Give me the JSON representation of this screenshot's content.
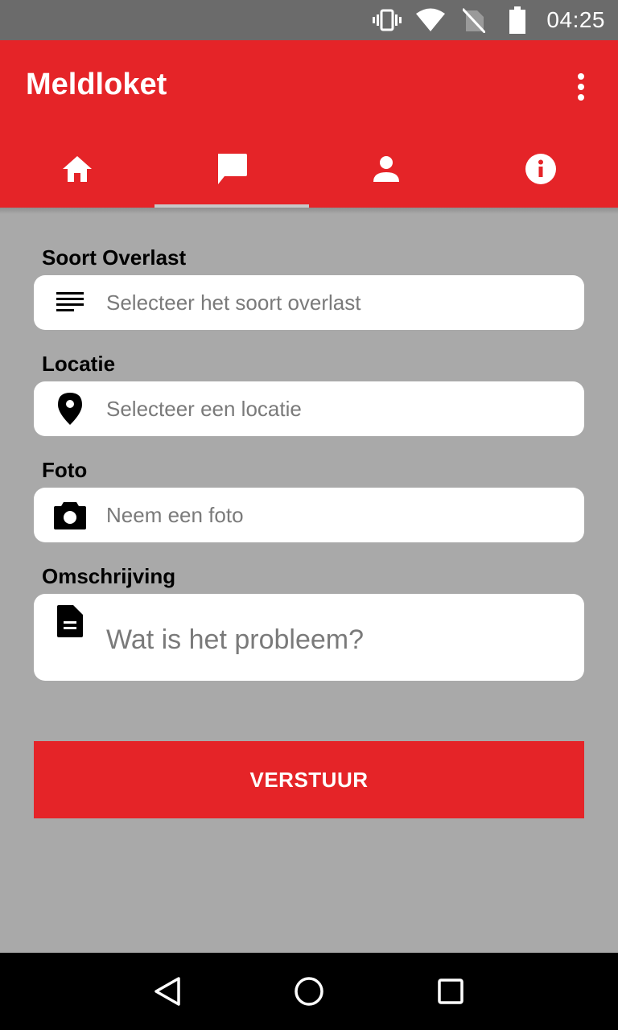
{
  "status_bar": {
    "time": "04:25",
    "icons": [
      "vibrate-icon",
      "wifi-icon",
      "no-sim-icon",
      "battery-icon"
    ]
  },
  "app_bar": {
    "title": "Meldloket",
    "overflow_icon": "more-vert-icon"
  },
  "tabs": [
    {
      "icon": "home-icon",
      "active": false
    },
    {
      "icon": "chat-icon",
      "active": true
    },
    {
      "icon": "person-icon",
      "active": false
    },
    {
      "icon": "info-icon",
      "active": false
    }
  ],
  "form": {
    "soort_overlast": {
      "label": "Soort Overlast",
      "placeholder": "Selecteer het soort overlast",
      "icon": "subject-icon"
    },
    "locatie": {
      "label": "Locatie",
      "placeholder": "Selecteer een locatie",
      "icon": "location-pin-icon"
    },
    "foto": {
      "label": "Foto",
      "placeholder": "Neem een foto",
      "icon": "camera-icon"
    },
    "omschrijving": {
      "label": "Omschrijving",
      "placeholder": "Wat is het probleem?",
      "icon": "document-icon"
    }
  },
  "submit_label": "VERSTUUR",
  "colors": {
    "accent": "#e52428",
    "background": "#a9a9a9",
    "status_bar": "#6b6b6b"
  },
  "nav_bar": {
    "icons": [
      "back-icon",
      "home-circle-icon",
      "recents-icon"
    ]
  }
}
